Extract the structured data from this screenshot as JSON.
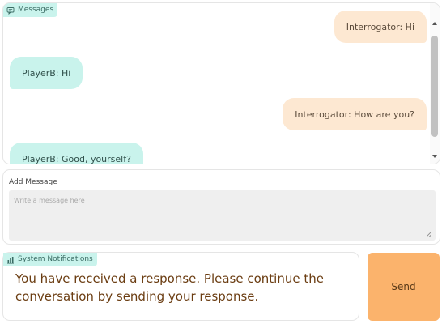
{
  "messages_panel": {
    "title": "Messages",
    "messages": [
      {
        "sender": "Interrogator",
        "text": "Interrogator: Hi",
        "side": "right"
      },
      {
        "sender": "PlayerB",
        "text": "PlayerB: Hi",
        "side": "left"
      },
      {
        "sender": "Interrogator",
        "text": "Interrogator: How are you?",
        "side": "right"
      },
      {
        "sender": "PlayerB",
        "text": "PlayerB: Good, yourself?",
        "side": "left"
      }
    ]
  },
  "add_message": {
    "label": "Add Message",
    "placeholder": "Write a message here",
    "value": ""
  },
  "notifications": {
    "title": "System Notifications",
    "text": "You have received a response. Please continue the conversation by sending your response."
  },
  "send": {
    "label": "Send"
  },
  "colors": {
    "mint": "#c9f3ec",
    "peach": "#fde8d2",
    "send": "#fbb36c",
    "notif_text": "#6b3d12"
  }
}
